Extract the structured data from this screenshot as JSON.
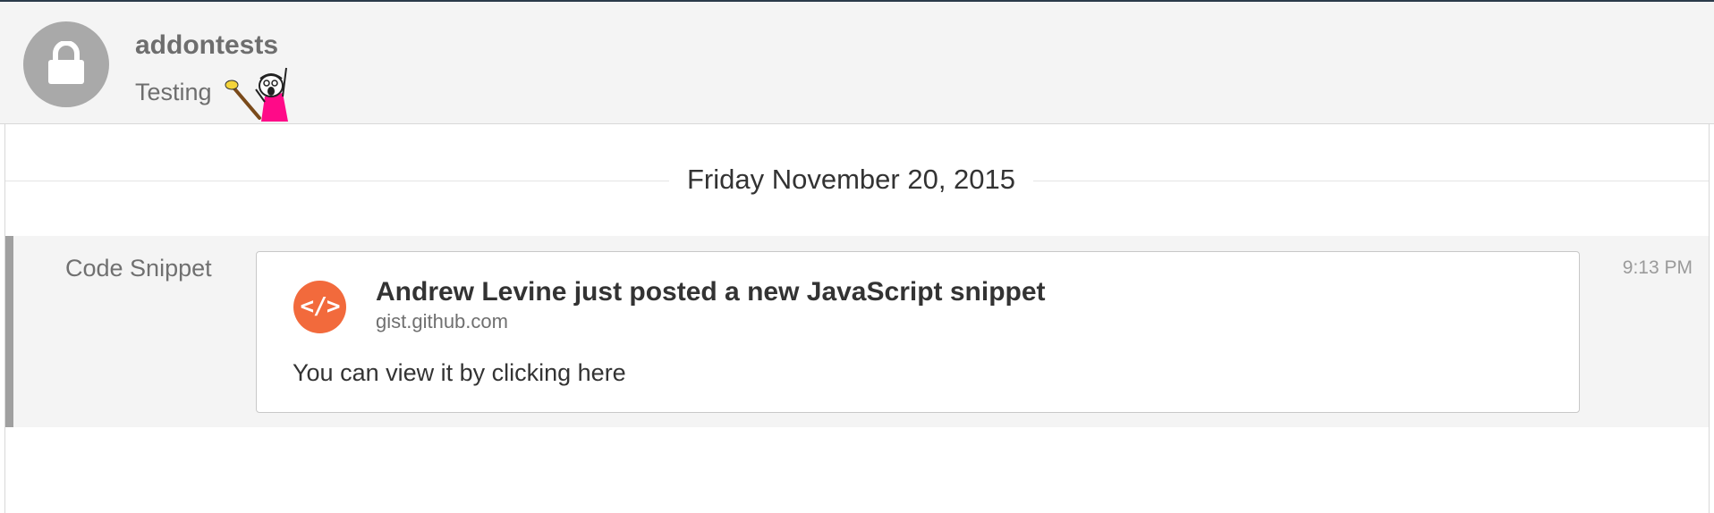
{
  "channel": {
    "name": "addontests",
    "topic": "Testing",
    "avatar_icon": "lock-icon",
    "topic_sticker": "all-the-things-sticker"
  },
  "feed": {
    "date_divider": "Friday November 20, 2015"
  },
  "message": {
    "sender": "Code Snippet",
    "time": "9:13 PM",
    "attachment": {
      "icon": "code-brackets-icon",
      "icon_glyph": "</>",
      "icon_color": "#f26a3c",
      "title": "Andrew Levine just posted a new JavaScript snippet",
      "source": "gist.github.com",
      "body": "You can view it by clicking here"
    }
  }
}
